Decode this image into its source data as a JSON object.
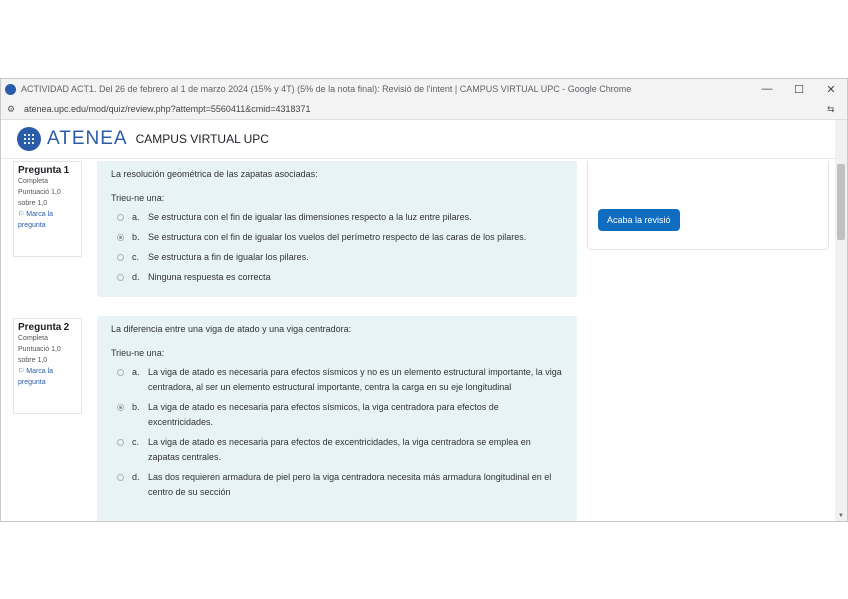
{
  "window": {
    "title": "ACTIVIDAD ACT1. Del 26 de febrero al 1 de marzo 2024 (15% y 4T) (5% de la nota final): Revisió de l'intent | CAMPUS VIRTUAL UPC - Google Chrome",
    "minimize": "—",
    "maximize": "☐",
    "close": "✕"
  },
  "address": {
    "url": "atenea.upc.edu/mod/quiz/review.php?attempt=5560411&cmid=4318371"
  },
  "header": {
    "brand": "ATENEA",
    "subtitle": "CAMPUS VIRTUAL UPC"
  },
  "nav": {
    "finish_label": "Acaba la revisió"
  },
  "questions": [
    {
      "label": "Pregunta",
      "number": "1",
      "status": "Completa",
      "score": "Puntuació 1,0 sobre 1,0",
      "flag": "Marca la pregunta",
      "text": "La resolución geométrica de las zapatas asociadas:",
      "prompt": "Trieu-ne una:",
      "options": [
        {
          "letter": "a.",
          "text": "Se estructura con el fin de igualar las dimensiones respecto a la luz entre pilares."
        },
        {
          "letter": "b.",
          "text": "Se estructura con el fin de igualar los vuelos del perímetro respecto de las caras de los pilares."
        },
        {
          "letter": "c.",
          "text": "Se estructura a fin de igualar los pilares."
        },
        {
          "letter": "d.",
          "text": "Ninguna respuesta es correcta"
        }
      ]
    },
    {
      "label": "Pregunta",
      "number": "2",
      "status": "Completa",
      "score": "Puntuació 1,0 sobre 1,0",
      "flag": "Marca la pregunta",
      "text": "La diferencia entre una viga de atado y una viga centradora:",
      "prompt": "Trieu-ne una:",
      "options": [
        {
          "letter": "a.",
          "text": "La viga de atado es necesaria para efectos sísmicos y no es un elemento estructural importante, la viga centradora, al ser un elemento estructural importante, centra la carga en su eje longitudinal"
        },
        {
          "letter": "b.",
          "text": "La viga de atado es necesaria para efectos sísmicos, la viga centradora para efectos de excentricidades."
        },
        {
          "letter": "c.",
          "text": "La viga de atado es necesaria para efectos de excentricidades, la viga centradora se emplea en zapatas centrales."
        },
        {
          "letter": "d.",
          "text": "Las dos requieren armadura de piel pero la viga centradora necesita más armadura longitudinal en el centro de su sección"
        }
      ]
    }
  ]
}
